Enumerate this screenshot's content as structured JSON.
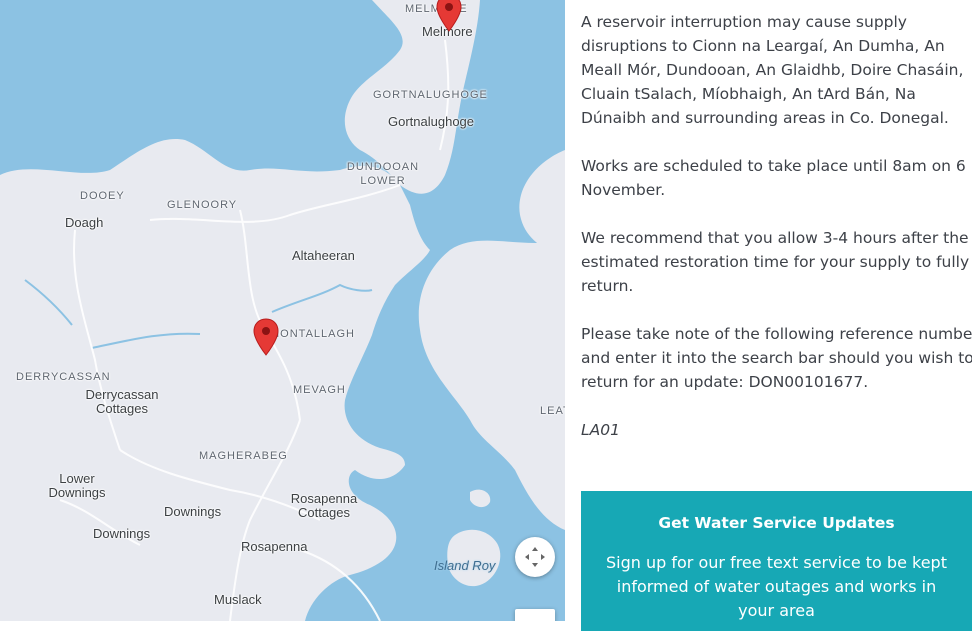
{
  "map": {
    "places": {
      "melmore_caps": "MELMORE",
      "melmore": "Melmore",
      "gortnalughoge_caps": "GORTNALUGHOGE",
      "gortnalughoge": "Gortnalughoge",
      "dundooan_lower": "DUNDOOAN\nLOWER",
      "dooey": "DOOEY",
      "doagh": "Doagh",
      "glenoory": "GLENOORY",
      "altaheeran": "Altaheeran",
      "montallagh": "MONTALLAGH",
      "mevagh": "MEVAGH",
      "derrycassan_caps": "DERRYCASSAN",
      "derrycassan_cottages": "Derrycassan\nCottages",
      "magherabeg": "MAGHERABEG",
      "lower_downings": "Lower\nDownings",
      "downings_1": "Downings",
      "downings_2": "Downings",
      "rosapenna_cottages": "Rosapenna\nCottages",
      "rosapenna": "Rosapenna",
      "muslack": "Muslack",
      "leat": "LEAT",
      "island_roy": "Island Roy"
    },
    "pin_color": "#e53935",
    "land_color": "#e8eaf0",
    "water_color": "#8cc2e3",
    "controls": {
      "move_icon": "move-arrows-icon"
    }
  },
  "notice": {
    "paragraph_1": "A reservoir interruption may cause supply disruptions to Cionn na Leargaí, An Dumha, An Meall Mór, Dundooan, An Glaidhb, Doire Chasáin, Cluain tSalach, Míobhaigh, An tArd Bán, Na Dúnaibh and surrounding areas in Co. Donegal.",
    "paragraph_2": "Works are scheduled to take place until 8am on 6 November.",
    "paragraph_3": "We recommend that you allow 3-4 hours after the estimated restoration time for your supply to fully return.",
    "paragraph_4": "Please take note of the following reference number and enter it into the search bar should you wish to return for an update: DON00101677.",
    "area_code": "LA01"
  },
  "cta": {
    "title": "Get Water Service Updates",
    "body": "Sign up for our free text service to be kept informed of water outages and works in your area",
    "background": "#17a8b5"
  }
}
